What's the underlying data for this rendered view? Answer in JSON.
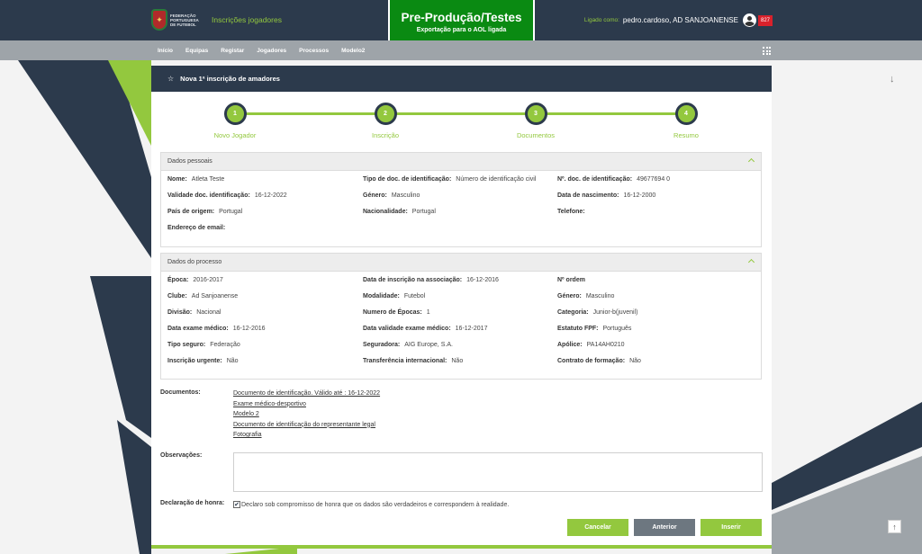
{
  "header": {
    "app_title": "Inscrições jogadores",
    "logo_text": "Federação Portuguesa de Futebol",
    "env_title": "Pre-Produção/Testes",
    "env_subtitle": "Exportação para o AOL ligada",
    "user_label": "Ligado como:",
    "user_name": "pedro.cardoso, AD SANJOANENSE",
    "user_badge": "827"
  },
  "nav": {
    "items": [
      "Início",
      "Equipas",
      "Registar",
      "Jogadores",
      "Processos",
      "Modelo2"
    ]
  },
  "panel": {
    "title": "Nova 1ª inscrição de amadores"
  },
  "stepper": {
    "steps": [
      {
        "number": "1",
        "label": "Novo Jogador"
      },
      {
        "number": "2",
        "label": "Inscrição"
      },
      {
        "number": "3",
        "label": "Documentos"
      },
      {
        "number": "4",
        "label": "Resumo"
      }
    ]
  },
  "personal": {
    "title": "Dados pessoais",
    "fields": [
      {
        "label": "Nome:",
        "value": "Atleta Teste"
      },
      {
        "label": "Tipo de doc. de identificação:",
        "value": "Número de identificação civil"
      },
      {
        "label": "Nº. doc. de identificação:",
        "value": "49677694 0"
      },
      {
        "label": "Validade doc. identificação:",
        "value": "16-12-2022"
      },
      {
        "label": "Género:",
        "value": "Masculino"
      },
      {
        "label": "Data de nascimento:",
        "value": "16-12-2000"
      },
      {
        "label": "País de origem:",
        "value": "Portugal"
      },
      {
        "label": "Nacionalidade:",
        "value": "Portugal"
      },
      {
        "label": "Telefone:",
        "value": ""
      },
      {
        "label": "Endereço de email:",
        "value": ""
      }
    ]
  },
  "process": {
    "title": "Dados do processo",
    "fields": [
      {
        "label": "Época:",
        "value": "2016-2017"
      },
      {
        "label": "Data de inscrição na associação:",
        "value": "16-12-2016"
      },
      {
        "label": "Nº ordem",
        "value": ""
      },
      {
        "label": "Clube:",
        "value": "Ad Sanjoanense"
      },
      {
        "label": "Modalidade:",
        "value": "Futebol"
      },
      {
        "label": "Género:",
        "value": "Masculino"
      },
      {
        "label": "Divisão:",
        "value": "Nacional"
      },
      {
        "label": "Numero de Épocas:",
        "value": "1"
      },
      {
        "label": "Categoria:",
        "value": "Junior-b(juvenil)"
      },
      {
        "label": "Data exame médico:",
        "value": "16-12-2016"
      },
      {
        "label": "Data validade exame médico:",
        "value": "16-12-2017"
      },
      {
        "label": "Estatuto FPF:",
        "value": "Português"
      },
      {
        "label": "Tipo seguro:",
        "value": "Federação"
      },
      {
        "label": "Seguradora:",
        "value": "AIG Europe, S.A."
      },
      {
        "label": "Apólice:",
        "value": "PA14AH0210"
      },
      {
        "label": "Inscrição urgente:",
        "value": "Não"
      },
      {
        "label": "Transferência internacional:",
        "value": "Não"
      },
      {
        "label": "Contrato de formação:",
        "value": "Não"
      }
    ]
  },
  "documents": {
    "label": "Documentos:",
    "links": [
      "Documento de identificação. Válido até : 16-12-2022",
      "Exame médico-desportivo",
      "Modelo 2",
      "Documento de identificação do representante legal",
      "Fotografia"
    ]
  },
  "observations": {
    "label": "Observações:",
    "value": ""
  },
  "declaration": {
    "label": "Declaração de honra:",
    "text": "Declaro sob compromisso de honra que os dados são verdadeiros e correspondem à realidade.",
    "checked": true
  },
  "buttons": {
    "cancel": "Cancelar",
    "previous": "Anterior",
    "submit": "Inserir"
  },
  "icons": {
    "scroll_down": "↓",
    "scroll_top": "↑",
    "star": "☆",
    "check": "✔"
  },
  "colors": {
    "navy": "#2c3a4c",
    "green": "#93c83e",
    "env_green": "#0a8a12",
    "nav_gray": "#9ea4a9",
    "button_gray": "#6d7780",
    "badge_red": "#d9212b"
  }
}
